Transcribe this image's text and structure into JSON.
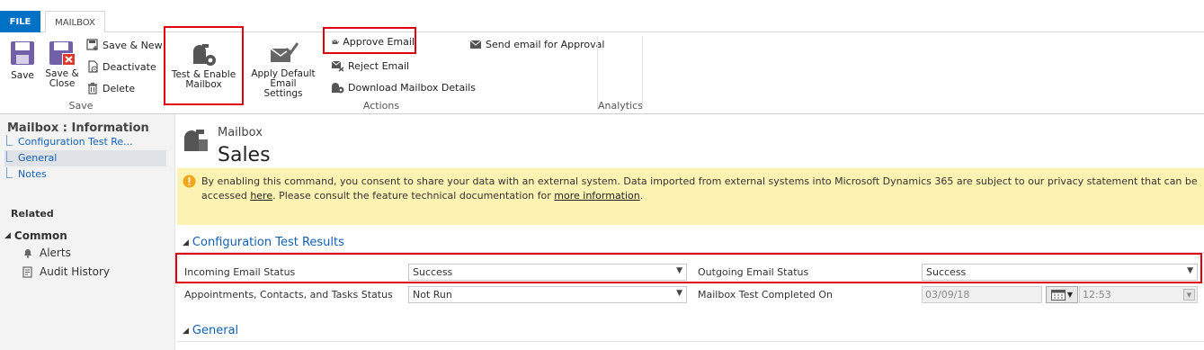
{
  "tabs": {
    "file": "FILE",
    "mailbox": "MAILBOX"
  },
  "ribbon": {
    "save": {
      "save": "Save",
      "save_close_1": "Save &",
      "save_close_2": "Close",
      "save_new": "Save & New",
      "deactivate": "Deactivate",
      "delete": "Delete",
      "label": "Save"
    },
    "actions": {
      "test_enable_1": "Test & Enable",
      "test_enable_2": "Mailbox",
      "apply_default_1": "Apply Default Email",
      "apply_default_2": "Settings",
      "approve_email": "Approve Email",
      "reject_email": "Reject Email",
      "download_details": "Download Mailbox Details",
      "send_for_approval": "Send email for Approval",
      "label": "Actions"
    },
    "analytics": {
      "label": "Analytics"
    }
  },
  "nav": {
    "title": "Mailbox : Information",
    "items": [
      "Configuration Test Re...",
      "General",
      "Notes"
    ],
    "related": "Related",
    "common": "Common",
    "common_items": [
      "Alerts",
      "Audit History"
    ]
  },
  "header": {
    "entity_type": "Mailbox",
    "record_name": "Sales"
  },
  "alert": {
    "text_1": "By enabling this command, you consent to share your data with an external system. Data imported from external systems into Microsoft Dynamics 365 are subject to our privacy statement that can be accessed ",
    "link_here": "here",
    "text_2": ". Please consult the feature technical documentation for ",
    "link_more": "more information",
    "text_3": "."
  },
  "sections": {
    "config": {
      "title": "Configuration Test Results",
      "incoming_label": "Incoming Email Status",
      "incoming_value": "Success",
      "outgoing_label": "Outgoing Email Status",
      "outgoing_value": "Success",
      "appointments_label": "Appointments, Contacts, and Tasks Status",
      "appointments_value": "Not Run",
      "completed_label": "Mailbox Test Completed On",
      "completed_date": "03/09/18",
      "completed_time": "12:53"
    },
    "general": {
      "title": "General"
    }
  },
  "colors": {
    "accent": "#0072c6",
    "highlight": "#e0000f",
    "alert_bg": "#fcf3b3",
    "link": "#1160b7"
  }
}
